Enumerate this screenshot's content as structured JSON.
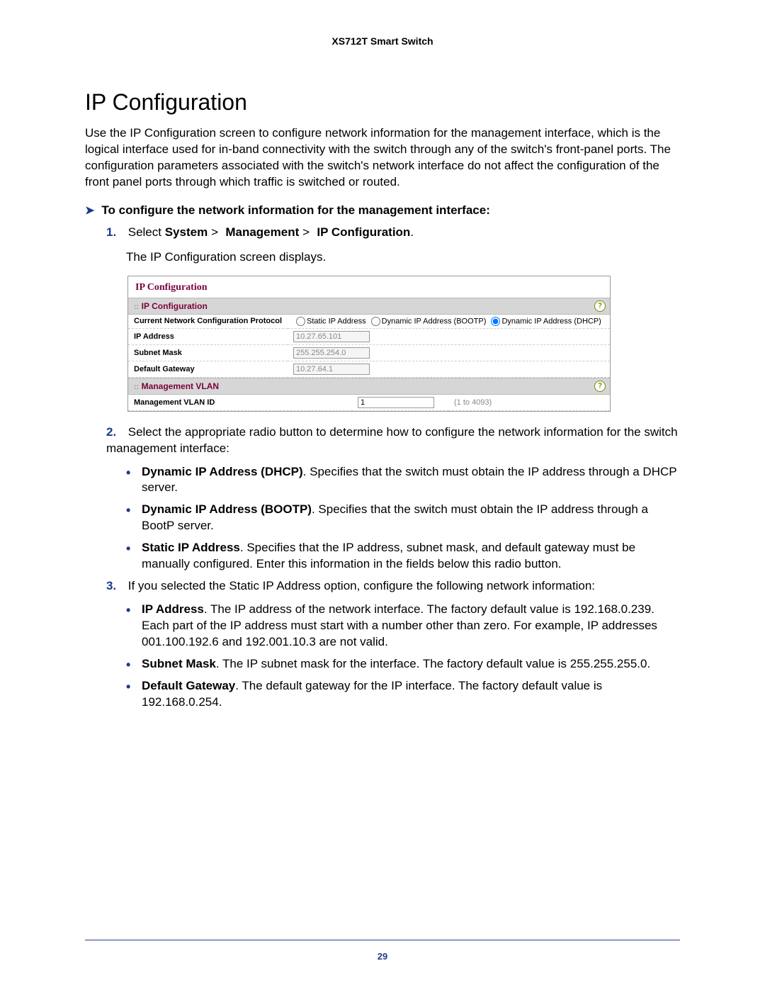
{
  "header": {
    "product": "XS712T Smart Switch"
  },
  "title": "IP Configuration",
  "intro": "Use the IP Configuration screen to configure network information for the management interface, which is the logical interface used for in-band connectivity with the switch through any of the switch's front-panel ports. The configuration parameters associated with the switch's network interface do not affect the configuration of the front panel ports through which traffic is switched or routed.",
  "task_heading": "To configure the network information for the management interface:",
  "steps": {
    "s1_prefix": "Select ",
    "s1_nav1": "System",
    "s1_nav2": "Management",
    "s1_nav3": "IP Configuration",
    "s1_result": "The IP Configuration screen displays.",
    "s2_text": "Select the appropriate radio button to determine how to configure the network information for the switch management interface:",
    "s3_text": "If you selected the Static IP Address option, configure the following network information:"
  },
  "opt_bullets": {
    "b1_label": "Dynamic IP Address (DHCP)",
    "b1_text": ". Specifies that the switch must obtain the IP address through a DHCP server.",
    "b2_label": "Dynamic IP Address (BOOTP)",
    "b2_text": ". Specifies that the switch must obtain the IP address through a BootP server.",
    "b3_label": "Static IP Address",
    "b3_text": ". Specifies that the IP address, subnet mask, and default gateway must be manually configured. Enter this information in the fields below this radio button."
  },
  "net_bullets": {
    "n1_label": "IP Address",
    "n1_text": ". The IP address of the network interface. The factory default value is 192.168.0.239. Each part of the IP address must start with a number other than zero. For example, IP addresses 001.100.192.6 and 192.001.10.3 are not valid.",
    "n2_label": "Subnet Mask",
    "n2_text": ". The IP subnet mask for the interface. The factory default value is 255.255.255.0.",
    "n3_label": "Default Gateway",
    "n3_text": ". The default gateway for the IP interface. The factory default value is 192.168.0.254."
  },
  "panel": {
    "title": "IP Configuration",
    "ipconf": {
      "section": "IP Configuration",
      "proto_label": "Current Network Configuration Protocol",
      "opt_static": "Static IP Address",
      "opt_bootp": "Dynamic IP Address (BOOTP)",
      "opt_dhcp": "Dynamic IP Address (DHCP)",
      "selected": "dhcp",
      "ip_label": "IP Address",
      "ip_value": "10.27.65.101",
      "mask_label": "Subnet Mask",
      "mask_value": "255.255.254.0",
      "gw_label": "Default Gateway",
      "gw_value": "10.27.64.1"
    },
    "mgmt": {
      "section": "Management VLAN",
      "id_label": "Management VLAN ID",
      "id_value": "1",
      "id_hint": "(1 to 4093)"
    }
  },
  "page_number": "29"
}
